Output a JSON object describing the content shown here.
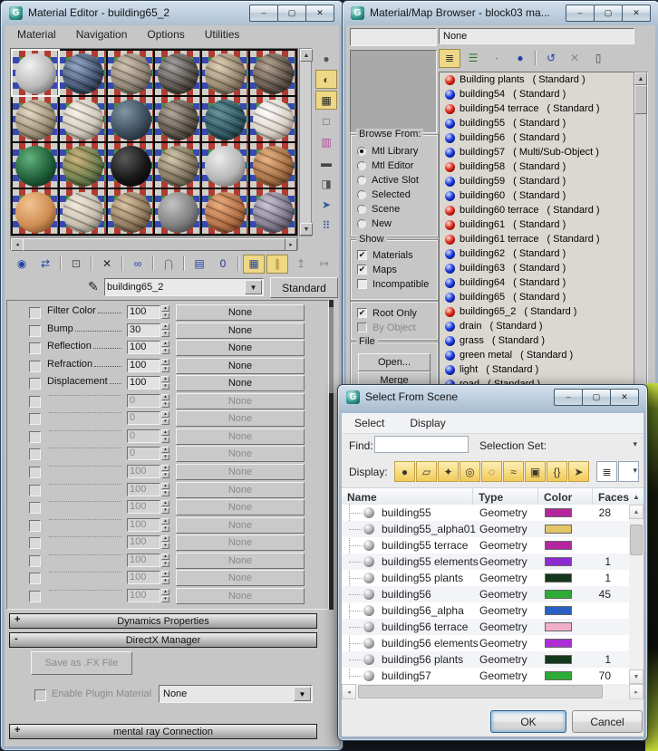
{
  "chrome": {
    "window_buttons": [
      {
        "name": "minimize-button",
        "glyph": "–"
      },
      {
        "name": "maximize-button",
        "glyph": "▢"
      },
      {
        "name": "close-button",
        "glyph": "✕"
      }
    ],
    "glyphs": {
      "up": "▲",
      "down": "▼",
      "left": "◂",
      "right": "▸",
      "spin_up": "▴",
      "spin_down": "▾",
      "drop": "▼",
      "small_drop": "▾",
      "check": "✔",
      "eyedropper": "✎"
    }
  },
  "material_editor": {
    "title": "Material Editor - building65_2",
    "menus": [
      "Material",
      "Navigation",
      "Options",
      "Utilities"
    ],
    "slots": [
      {
        "hi": "#f2f2f2",
        "base": "#b9b9b9",
        "dark": "#565656",
        "tex": false
      },
      {
        "hi": "#93a6c6",
        "base": "#41536f",
        "dark": "#13161c",
        "tex": true
      },
      {
        "hi": "#d3c4ae",
        "base": "#8d8274",
        "dark": "#3a352c",
        "tex": true
      },
      {
        "hi": "#a3a3a3",
        "base": "#575049",
        "dark": "#1d1a17",
        "tex": true
      },
      {
        "hi": "#e0cfb4",
        "base": "#93836c",
        "dark": "#42382e",
        "tex": true
      },
      {
        "hi": "#b5a390",
        "base": "#60544a",
        "dark": "#261f19",
        "tex": true
      },
      {
        "hi": "#e6d9c4",
        "base": "#9e9078",
        "dark": "#473e31",
        "tex": true
      },
      {
        "hi": "#f8f3ea",
        "base": "#cdc5b8",
        "dark": "#5a5249",
        "tex": true
      },
      {
        "hi": "#8095a6",
        "base": "#3c4d5c",
        "dark": "#141a20",
        "tex": false
      },
      {
        "hi": "#b4a89a",
        "base": "#5a5147",
        "dark": "#231f1a",
        "tex": true
      },
      {
        "hi": "#639097",
        "base": "#2f5862",
        "dark": "#112227",
        "tex": true
      },
      {
        "hi": "#ffffff",
        "base": "#d9d0c7",
        "dark": "#6b5a4e",
        "tex": true
      },
      {
        "hi": "#63b27d",
        "base": "#1f5e39",
        "dark": "#0a2517",
        "tex": false
      },
      {
        "hi": "#cdb37c",
        "base": "#6d7c4b",
        "dark": "#2b2f1a",
        "tex": true
      },
      {
        "hi": "#5a5a5a",
        "base": "#171717",
        "dark": "#000000",
        "tex": false
      },
      {
        "hi": "#d5c8aa",
        "base": "#7e725e",
        "dark": "#352d22",
        "tex": true
      },
      {
        "hi": "#ececec",
        "base": "#b7b7b7",
        "dark": "#575757",
        "tex": false
      },
      {
        "hi": "#eab384",
        "base": "#a56d42",
        "dark": "#48291a",
        "tex": true
      },
      {
        "hi": "#f3c392",
        "base": "#cf8d52",
        "dark": "#603b1f",
        "tex": false
      },
      {
        "hi": "#f3ebdb",
        "base": "#c3bbab",
        "dark": "#575149",
        "tex": true
      },
      {
        "hi": "#dcc4a3",
        "base": "#8d765a",
        "dark": "#3b3021",
        "tex": true
      },
      {
        "hi": "#c4c4c4",
        "base": "#7f7f7f",
        "dark": "#343434",
        "tex": false
      },
      {
        "hi": "#eaab7a",
        "base": "#b26c43",
        "dark": "#4c2b19",
        "tex": true
      },
      {
        "hi": "#ccc4d4",
        "base": "#7d7689",
        "dark": "#2f2b37",
        "tex": true
      }
    ],
    "side_tools": [
      {
        "name": "sample-type-icon",
        "glyph": "●",
        "hl": false,
        "color": "#555"
      },
      {
        "name": "backlight-icon",
        "glyph": "◐",
        "hl": true,
        "color": "#444"
      },
      {
        "name": "background-icon",
        "glyph": "▦",
        "hl": true,
        "color": "#222"
      },
      {
        "name": "sample-uv-tiling-icon",
        "glyph": "□",
        "hl": false,
        "color": "#555"
      },
      {
        "name": "video-color-check-icon",
        "glyph": "▥",
        "hl": false,
        "color": "#b04a9a"
      },
      {
        "name": "make-preview-icon",
        "glyph": "▬",
        "hl": false,
        "color": "#444"
      },
      {
        "name": "options-icon",
        "glyph": "◨",
        "hl": false,
        "color": "#555"
      },
      {
        "name": "select-by-material-icon",
        "glyph": "➤",
        "hl": false,
        "color": "#335a9a"
      },
      {
        "name": "material-map-navigator-icon",
        "glyph": "⠿",
        "hl": false,
        "color": "#2a46a8"
      }
    ],
    "toolbar": [
      {
        "name": "get-material-icon",
        "glyph": "◉",
        "color": "#2241a6"
      },
      {
        "name": "put-material-to-scene-icon",
        "glyph": "⇄",
        "color": "#2241a6"
      },
      {
        "sep": true
      },
      {
        "name": "assign-material-icon",
        "glyph": "⊡",
        "color": "#555"
      },
      {
        "sep": true
      },
      {
        "name": "reset-map-icon",
        "glyph": "✕",
        "color": "#222"
      },
      {
        "sep": true
      },
      {
        "name": "make-material-copy-icon",
        "glyph": "∞",
        "color": "#2241a6"
      },
      {
        "sep": true
      },
      {
        "name": "make-unique-icon",
        "glyph": "⋂",
        "color": "#777"
      },
      {
        "sep": true
      },
      {
        "name": "put-to-library-icon",
        "glyph": "▤",
        "color": "#2241a6"
      },
      {
        "name": "material-id-channel-icon",
        "glyph": "0",
        "color": "#1a3a8a"
      },
      {
        "sep": true
      },
      {
        "name": "show-map-in-viewport-icon",
        "glyph": "▦",
        "color": "#2241a6",
        "hl": true
      },
      {
        "name": "show-end-result-icon",
        "glyph": "∥",
        "color": "#b07818",
        "hl": true
      },
      {
        "name": "go-to-parent-icon",
        "glyph": "↥",
        "color": "#888"
      },
      {
        "name": "go-forward-sibling-icon",
        "glyph": "↦",
        "color": "#888"
      }
    ],
    "name_value": "building65_2",
    "type_button": "Standard",
    "params": [
      {
        "label": "Filter Color",
        "value": "100",
        "map": "None",
        "on": true
      },
      {
        "label": "Bump",
        "value": "30",
        "map": "None",
        "on": true
      },
      {
        "label": "Reflection",
        "value": "100",
        "map": "None",
        "on": true
      },
      {
        "label": "Refraction",
        "value": "100",
        "map": "None",
        "on": true
      },
      {
        "label": "Displacement",
        "value": "100",
        "map": "None",
        "on": true
      },
      {
        "label": "",
        "value": "0",
        "map": "None",
        "on": false
      },
      {
        "label": "",
        "value": "0",
        "map": "None",
        "on": false
      },
      {
        "label": "",
        "value": "0",
        "map": "None",
        "on": false
      },
      {
        "label": "",
        "value": "0",
        "map": "None",
        "on": false
      },
      {
        "label": "",
        "value": "100",
        "map": "None",
        "on": false
      },
      {
        "label": "",
        "value": "100",
        "map": "None",
        "on": false
      },
      {
        "label": "",
        "value": "100",
        "map": "None",
        "on": false
      },
      {
        "label": "",
        "value": "100",
        "map": "None",
        "on": false
      },
      {
        "label": "",
        "value": "100",
        "map": "None",
        "on": false
      },
      {
        "label": "",
        "value": "100",
        "map": "None",
        "on": false
      },
      {
        "label": "",
        "value": "100",
        "map": "None",
        "on": false
      },
      {
        "label": "",
        "value": "100",
        "map": "None",
        "on": false
      }
    ],
    "rollouts": {
      "dynamics_state": "+",
      "dynamics": "Dynamics Properties",
      "directx_state": "-",
      "directx": "DirectX Manager",
      "mental_ray_state": "+",
      "mental_ray": "mental ray Connection"
    },
    "directx_panel": {
      "save_button": "Save as .FX File",
      "enable_label": "Enable Plugin Material",
      "plugin_value": "None"
    }
  },
  "browser": {
    "title": "Material/Map Browser - block03 ma...",
    "path_value": "None",
    "toolbar": [
      {
        "name": "view-list-icon",
        "glyph": "≣",
        "color": "#333",
        "hl": true
      },
      {
        "name": "view-list-plus-icon",
        "glyph": "☰",
        "color": "#2a7a2a"
      },
      {
        "name": "view-small-icons-icon",
        "glyph": "∙",
        "color": "#2241a6"
      },
      {
        "name": "view-large-icons-icon",
        "glyph": "●",
        "color": "#2241a6"
      },
      {
        "sep": true
      },
      {
        "name": "update-scene-materials-icon",
        "glyph": "↺",
        "color": "#2241a6"
      },
      {
        "name": "delete-from-library-icon",
        "glyph": "✕",
        "color": "#888"
      },
      {
        "name": "clear-material-library-icon",
        "glyph": "▯",
        "color": "#444"
      }
    ],
    "browse_from": {
      "label": "Browse From:",
      "options": [
        {
          "label": "Mtl Library",
          "on": true
        },
        {
          "label": "Mtl Editor",
          "on": false
        },
        {
          "label": "Active Slot",
          "on": false
        },
        {
          "label": "Selected",
          "on": false
        },
        {
          "label": "Scene",
          "on": false
        },
        {
          "label": "New",
          "on": false
        }
      ]
    },
    "show": {
      "label": "Show",
      "checks": [
        {
          "label": "Materials",
          "on": true,
          "en": true
        },
        {
          "label": "Maps",
          "on": true,
          "en": true
        },
        {
          "label": "Incompatible",
          "on": false,
          "en": true
        }
      ],
      "sub": [
        {
          "label": "Root Only",
          "on": true,
          "en": true
        },
        {
          "label": "By Object",
          "on": false,
          "en": false
        }
      ]
    },
    "file": {
      "label": "File",
      "open": "Open...",
      "merge": "Merge"
    },
    "materials": [
      {
        "name": "Building plants",
        "type": "( Standard )",
        "dot": "red"
      },
      {
        "name": "building54",
        "type": "( Standard )",
        "dot": "blue"
      },
      {
        "name": "building54 terrace",
        "type": "( Standard )",
        "dot": "red"
      },
      {
        "name": "building55",
        "type": "( Standard )",
        "dot": "blue"
      },
      {
        "name": "building56",
        "type": "( Standard )",
        "dot": "blue"
      },
      {
        "name": "building57",
        "type": "( Multi/Sub-Object )",
        "dot": "blue"
      },
      {
        "name": "building58",
        "type": "( Standard )",
        "dot": "red"
      },
      {
        "name": "building59",
        "type": "( Standard )",
        "dot": "blue"
      },
      {
        "name": "building60",
        "type": "( Standard )",
        "dot": "blue"
      },
      {
        "name": "building60 terrace",
        "type": "( Standard )",
        "dot": "red"
      },
      {
        "name": "building61",
        "type": "( Standard )",
        "dot": "red"
      },
      {
        "name": "building61 terrace",
        "type": "( Standard )",
        "dot": "red"
      },
      {
        "name": "building62",
        "type": "( Standard )",
        "dot": "blue"
      },
      {
        "name": "building63",
        "type": "( Standard )",
        "dot": "blue"
      },
      {
        "name": "building64",
        "type": "( Standard )",
        "dot": "blue"
      },
      {
        "name": "building65",
        "type": "( Standard )",
        "dot": "blue"
      },
      {
        "name": "building65_2",
        "type": "( Standard )",
        "dot": "red"
      },
      {
        "name": "drain",
        "type": "( Standard )",
        "dot": "blue"
      },
      {
        "name": "grass",
        "type": "( Standard )",
        "dot": "blue"
      },
      {
        "name": "green metal",
        "type": "( Standard )",
        "dot": "blue"
      },
      {
        "name": "light",
        "type": "( Standard )",
        "dot": "blue"
      },
      {
        "name": "road",
        "type": "( Standard )",
        "dot": "blue"
      }
    ]
  },
  "scene_dialog": {
    "title": "Select From Scene",
    "menus": [
      "Select",
      "Display"
    ],
    "find_label": "Find:",
    "selection_set_label": "Selection Set:",
    "display_label": "Display:",
    "display_buttons": [
      {
        "name": "display-geometry-icon",
        "glyph": "●",
        "hl": true
      },
      {
        "name": "display-shapes-icon",
        "glyph": "▱",
        "hl": true
      },
      {
        "name": "display-lights-icon",
        "glyph": "✦",
        "hl": true
      },
      {
        "name": "display-cameras-icon",
        "glyph": "◎",
        "hl": true
      },
      {
        "name": "display-helpers-icon",
        "glyph": "◌",
        "hl": true
      },
      {
        "name": "display-spacewarps-icon",
        "glyph": "≈",
        "hl": true
      },
      {
        "name": "display-groups-icon",
        "glyph": "▣",
        "hl": true
      },
      {
        "name": "display-xrefs-icon",
        "glyph": "{}",
        "hl": true
      },
      {
        "name": "display-bones-icon",
        "glyph": "➤",
        "hl": true
      },
      {
        "name": "display-children-icon",
        "glyph": "≣",
        "hl": false
      },
      {
        "name": "display-blank-icon",
        "glyph": "",
        "hl": false
      }
    ],
    "columns": {
      "name": "Name",
      "type": "Type",
      "color": "Color",
      "faces": "Faces",
      "sort": "▲"
    },
    "rows": [
      {
        "name": "building55",
        "type": "Geometry",
        "color": "#b5269e",
        "faces": "28"
      },
      {
        "name": "building55_alpha01",
        "type": "Geometry",
        "color": "#e2c568",
        "faces": ""
      },
      {
        "name": "building55 terrace",
        "type": "Geometry",
        "color": "#b5269e",
        "faces": ""
      },
      {
        "name": "building55 elements",
        "type": "Geometry",
        "color": "#8c2bd0",
        "faces": "1"
      },
      {
        "name": "building55 plants",
        "type": "Geometry",
        "color": "#14381c",
        "faces": "1"
      },
      {
        "name": "building56",
        "type": "Geometry",
        "color": "#2cab37",
        "faces": "45"
      },
      {
        "name": "building56_alpha",
        "type": "Geometry",
        "color": "#2a5fc4",
        "faces": ""
      },
      {
        "name": "building56 terrace",
        "type": "Geometry",
        "color": "#f0aecb",
        "faces": ""
      },
      {
        "name": "building56 elements",
        "type": "Geometry",
        "color": "#ae2ed6",
        "faces": ""
      },
      {
        "name": "building56 plants",
        "type": "Geometry",
        "color": "#14381c",
        "faces": "1"
      },
      {
        "name": "building57",
        "type": "Geometry",
        "color": "#2cab37",
        "faces": "70"
      }
    ],
    "ok": "OK",
    "cancel": "Cancel"
  }
}
